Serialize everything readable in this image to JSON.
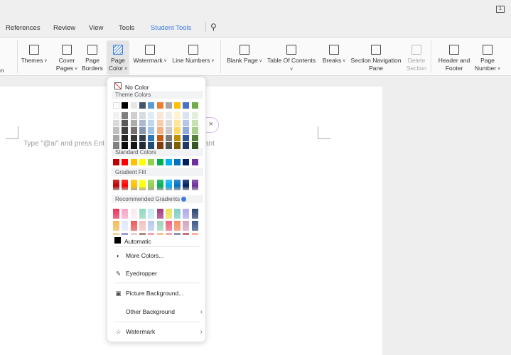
{
  "tabs": [
    "References",
    "Review",
    "View",
    "Tools",
    "Student Tools"
  ],
  "active_tab": "Student Tools",
  "top_right_badge": "1",
  "ribbon": {
    "partial_left": [
      "t",
      "on"
    ],
    "buttons": [
      {
        "label": "Themes",
        "dropdown": true
      },
      {
        "label": "Cover Pages",
        "dropdown": true
      },
      {
        "label": "Page Borders"
      },
      {
        "label": "Page Color",
        "dropdown": true,
        "selected": true
      },
      {
        "label": "Watermark",
        "dropdown": true
      },
      {
        "label": "Line Numbers",
        "dropdown": true
      },
      {
        "label": "Blank Page",
        "dropdown": true
      },
      {
        "label": "Table Of Contents",
        "dropdown": true
      },
      {
        "label": "Breaks",
        "dropdown": true
      },
      {
        "label": "Section Navigation Pane"
      },
      {
        "label": "Delete Section",
        "disabled": true
      },
      {
        "label": "Header and Footer"
      },
      {
        "label": "Page Number",
        "dropdown": true
      }
    ]
  },
  "document": {
    "placeholder_left": "Type \"@ai\" and press Ent",
    "placeholder_right": "ant"
  },
  "menu": {
    "no_color": "No Color",
    "theme_colors_heading": "Theme Colors",
    "theme_colors": [
      "#ffffff",
      "#000000",
      "#e7e6e6",
      "#44546a",
      "#5b9bd5",
      "#ed7d31",
      "#a5a5a5",
      "#ffc000",
      "#4472c4",
      "#70ad47"
    ],
    "theme_shades": [
      [
        "#f2f2f2",
        "#d9d9d9",
        "#bfbfbf",
        "#a6a6a6",
        "#808080"
      ],
      [
        "#7f7f7f",
        "#595959",
        "#3f3f3f",
        "#262626",
        "#0d0d0d"
      ],
      [
        "#d0cece",
        "#aeabab",
        "#757171",
        "#3a3838",
        "#171616"
      ],
      [
        "#d6dce4",
        "#adb9ca",
        "#8496b0",
        "#323f4f",
        "#222a35"
      ],
      [
        "#deebf6",
        "#bdd7ee",
        "#9dc3e6",
        "#2e75b5",
        "#1f4e79"
      ],
      [
        "#fbe5d5",
        "#f8cbad",
        "#f4b183",
        "#c55a11",
        "#843c0b"
      ],
      [
        "#ededed",
        "#dbdbdb",
        "#c9c9c9",
        "#7b7b7b",
        "#525252"
      ],
      [
        "#fff2cc",
        "#fee599",
        "#ffd965",
        "#bf9000",
        "#7f6000"
      ],
      [
        "#dae3f3",
        "#b4c7e7",
        "#8faadc",
        "#2f5597",
        "#203864"
      ],
      [
        "#e2efd9",
        "#c5e0b3",
        "#a8d08d",
        "#538135",
        "#375623"
      ]
    ],
    "standard_colors_heading": "Standard Colors",
    "standard_colors": [
      "#c00000",
      "#ff0000",
      "#ffc000",
      "#ffff00",
      "#92d050",
      "#00b050",
      "#00b0f0",
      "#0070c0",
      "#002060",
      "#7030a0"
    ],
    "gradient_fill_heading": "Gradient Fill",
    "recommended_heading": "Recommended Gradients",
    "recommended_row1": [
      "#e8365d",
      "#f4a7c8",
      "#fde8ee",
      "#8fd8bd",
      "#c5e9ef",
      "#a23b7e",
      "#ebe05a",
      "#7fcdc4",
      "#b1a9ea",
      "#2c4770"
    ],
    "recommended_row2": [
      "#f3bb5d",
      "#dfe8fb",
      "#ea5a5a",
      "#f7bfbf",
      "#b7c9ec",
      "#9fd5bb",
      "#f06282",
      "#f78e62",
      "#d5a4c0",
      "#3f5a8a"
    ],
    "recommended_row3": [
      "#f9d29a",
      "#9ba1c6",
      "#e2d3cf",
      "#a78e79",
      "#f3a3b0",
      "#f5c28d",
      "#f7a8b6",
      "#8a93b9",
      "#c97474",
      "#f7b3a2"
    ],
    "automatic": "Automatic",
    "more_colors": "More Colors...",
    "eyedropper": "Eyedropper",
    "picture_background": "Picture Background...",
    "other_background": "Other Background",
    "watermark": "Watermark"
  }
}
